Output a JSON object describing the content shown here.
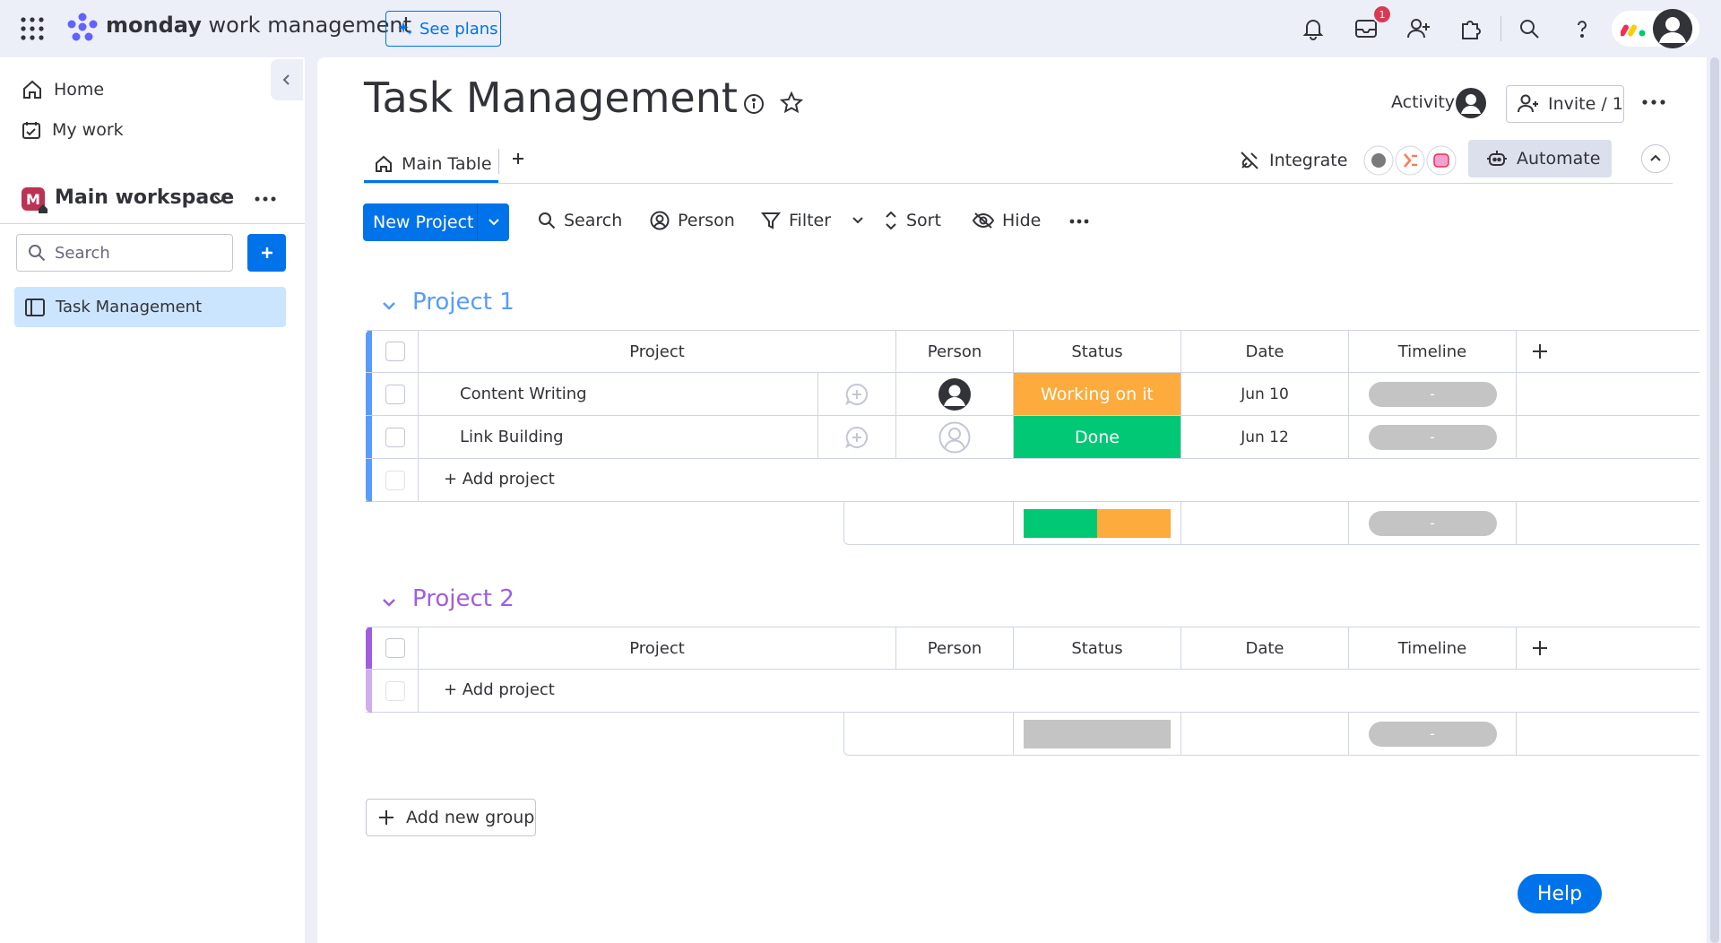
{
  "topbar": {
    "logo_bold": "monday",
    "logo_rest": " work management",
    "see_plans": "See plans",
    "inbox_badge": "1"
  },
  "sidebar": {
    "home": "Home",
    "my_work": "My work",
    "workspace_initial": "M",
    "workspace_name": "Main workspace",
    "search_placeholder": "Search",
    "board_name": "Task Management"
  },
  "board": {
    "title": "Task Management",
    "activity": "Activity",
    "invite": "Invite / 1",
    "tab_main": "Main Table",
    "integrate": "Integrate",
    "automate": "Automate"
  },
  "toolbar": {
    "new_project": "New Project",
    "search": "Search",
    "person": "Person",
    "filter": "Filter",
    "sort": "Sort",
    "hide": "Hide"
  },
  "columns": {
    "project": "Project",
    "person": "Person",
    "status": "Status",
    "date": "Date",
    "timeline": "Timeline"
  },
  "groups": [
    {
      "title": "Project 1",
      "color": "#579bfc",
      "rows": [
        {
          "name": "Content Writing",
          "status": "Working on it",
          "status_color": "#fdab3d",
          "date": "Jun 10",
          "timeline": "-",
          "person": "assigned"
        },
        {
          "name": "Link Building",
          "status": "Done",
          "status_color": "#00c875",
          "date": "Jun 12",
          "timeline": "-",
          "person": "empty"
        }
      ],
      "add_label": "+ Add project",
      "summary_timeline": "-",
      "status_summary": [
        {
          "color": "#00c875",
          "fraction": 0.5
        },
        {
          "color": "#fdab3d",
          "fraction": 0.5
        }
      ]
    },
    {
      "title": "Project 2",
      "color": "#a25ddc",
      "rows": [],
      "add_label": "+ Add project",
      "summary_timeline": "-",
      "status_summary": [
        {
          "color": "#c4c4c4",
          "fraction": 1
        }
      ]
    }
  ],
  "add_group": "Add new group",
  "help": "Help"
}
